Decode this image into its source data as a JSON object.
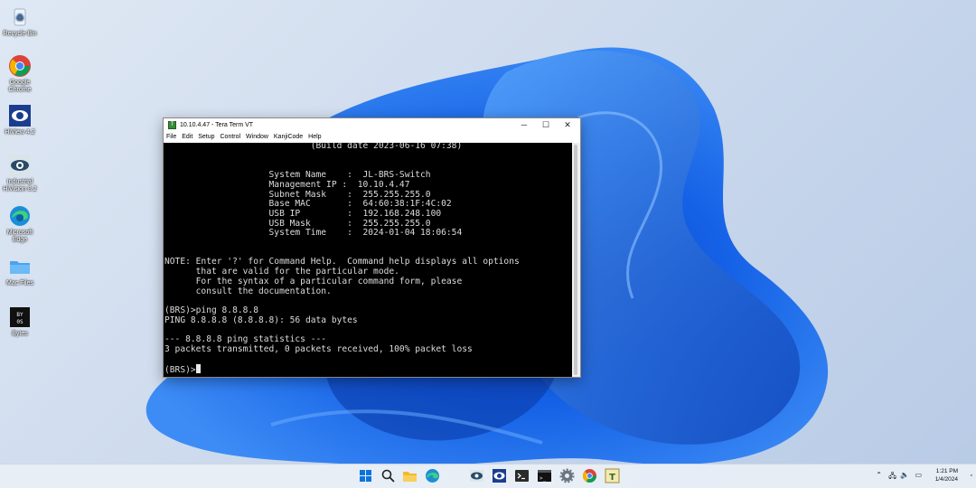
{
  "desktop": {
    "icons": [
      {
        "label": "Recycle Bin",
        "icon": "recycle-bin-icon"
      },
      {
        "label": "Google Chrome",
        "icon": "chrome-icon"
      },
      {
        "label": "HiView 4.2",
        "icon": "hiview-icon"
      },
      {
        "label": "Industrial HiVision 8.2",
        "icon": "industrial-hivision-icon"
      },
      {
        "label": "Microsoft Edge",
        "icon": "edge-icon"
      },
      {
        "label": "Mac Files",
        "icon": "folder-icon"
      },
      {
        "label": "Bytes",
        "icon": "bytes-icon"
      }
    ]
  },
  "window": {
    "title": "10.10.4.47 - Tera Term VT",
    "controls": {
      "minimize": "─",
      "maximize": "☐",
      "close": "✕"
    },
    "menu": [
      "File",
      "Edit",
      "Setup",
      "Control",
      "Window",
      "KanjiCode",
      "Help"
    ]
  },
  "terminal": {
    "lines": [
      "                            (Build date 2023-06-16 07:38)",
      "",
      "",
      "                    System Name    :  JL-BRS-Switch",
      "                    Management IP :  10.10.4.47",
      "                    Subnet Mask    :  255.255.255.0",
      "                    Base MAC       :  64:60:38:1F:4C:02",
      "                    USB IP         :  192.168.248.100",
      "                    USB Mask       :  255.255.255.0",
      "                    System Time    :  2024-01-04 18:06:54",
      "",
      "",
      "NOTE: Enter '?' for Command Help.  Command help displays all options",
      "      that are valid for the particular mode.",
      "      For the syntax of a particular command form, please",
      "      consult the documentation.",
      "",
      "(BRS)>ping 8.8.8.8",
      "PING 8.8.8.8 (8.8.8.8): 56 data bytes",
      "",
      "--- 8.8.8.8 ping statistics ---",
      "3 packets transmitted, 0 packets received, 100% packet loss",
      ""
    ],
    "prompt": "(BRS)>"
  },
  "taskbar": {
    "icons": [
      "start-icon",
      "search-icon",
      "file-explorer-icon",
      "edge-icon",
      "industrial-hivision-icon",
      "hiview-icon",
      "terminal-icon",
      "command-prompt-icon",
      "settings-icon",
      "chrome-icon",
      "tera-term-icon"
    ],
    "time": "1:21 PM",
    "date": "1/4/2024"
  },
  "colors": {
    "terminal_bg": "#000000",
    "terminal_fg": "#dcdcdc",
    "accent": "#0a5fd8"
  }
}
